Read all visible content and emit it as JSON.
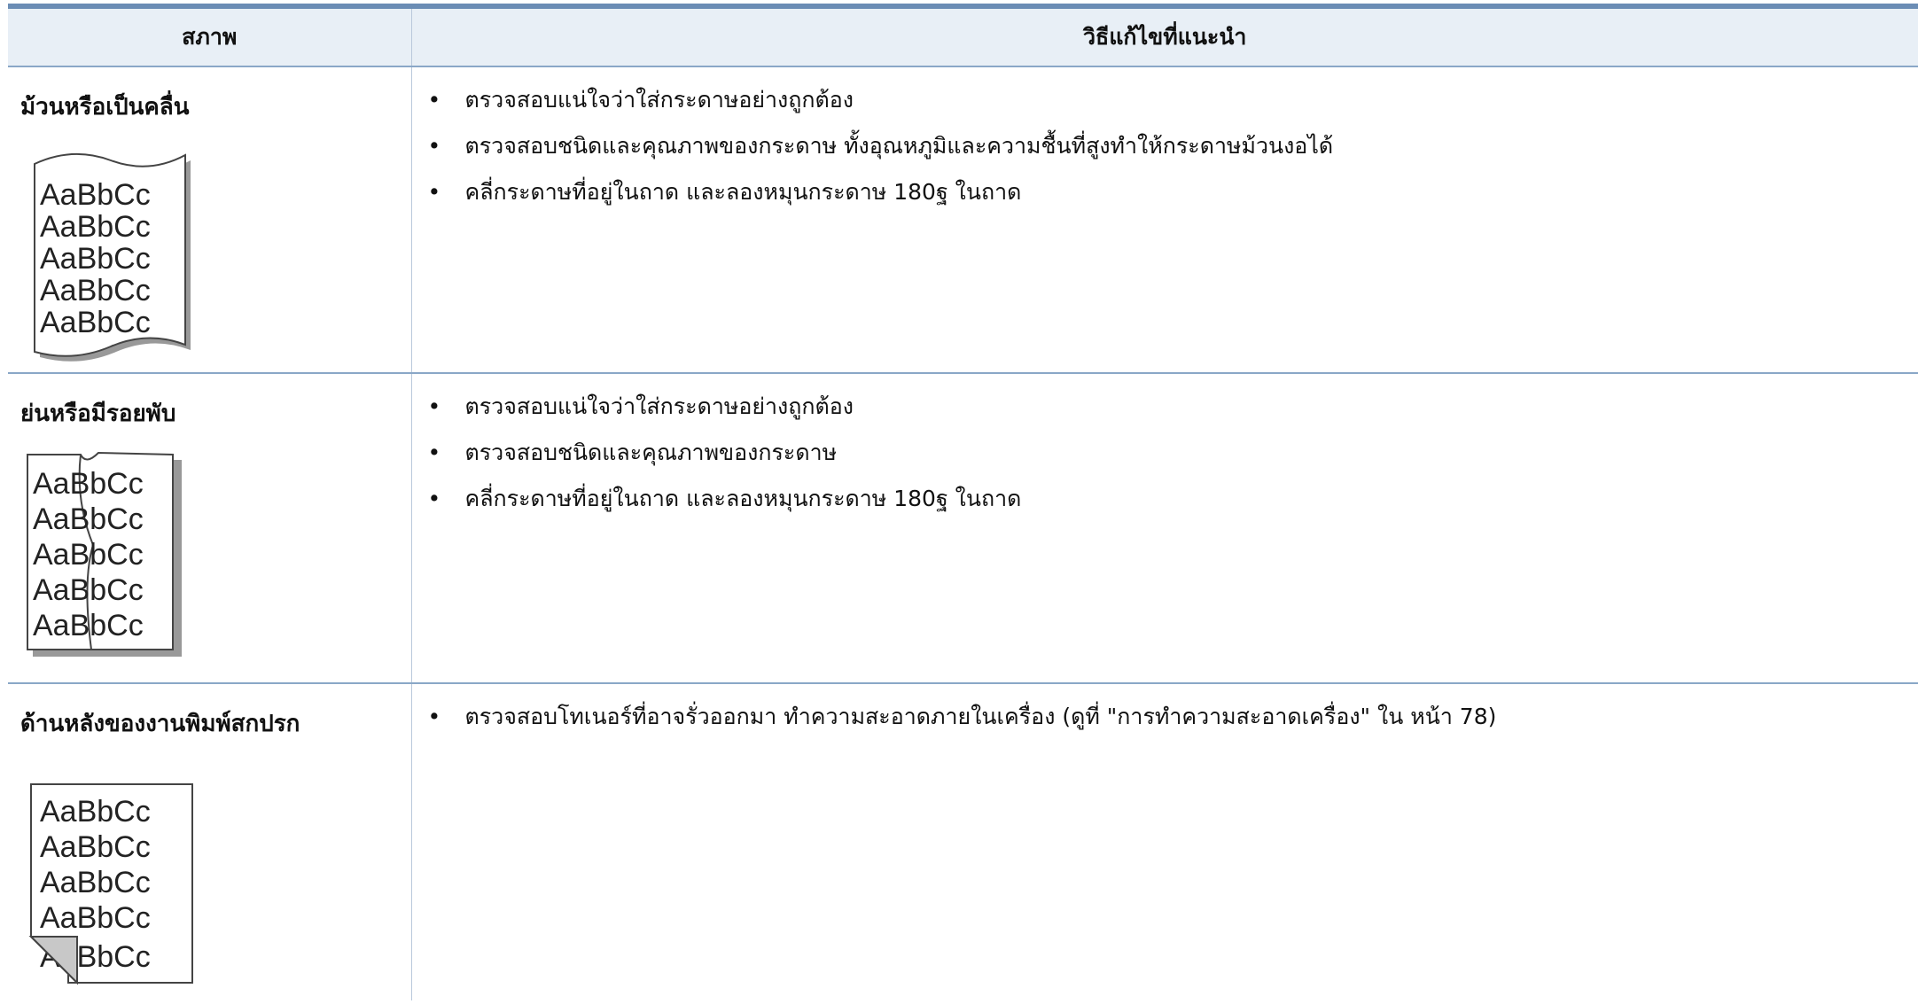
{
  "table": {
    "headers": [
      "สภาพ",
      "วิธีแก้ไขที่แนะนำ"
    ],
    "rows": [
      {
        "condition": "ม้วนหรือเป็นคลื่น",
        "sample_text": "AaBbCc",
        "solutions": [
          "ตรวจสอบแน่ใจว่าใส่กระดาษอย่างถูกต้อง",
          "ตรวจสอบชนิดและคุณภาพของกระดาษ ทั้งอุณหภูมิและความชื้นที่สูงทำให้กระดาษม้วนงอได้",
          "คลี่กระดาษที่อยู่ในถาด และลองหมุนกระดาษ 180ฐ ในถาด"
        ]
      },
      {
        "condition": "ย่นหรือมีรอยพับ",
        "sample_text": "AaBbCc",
        "solutions": [
          "ตรวจสอบแน่ใจว่าใส่กระดาษอย่างถูกต้อง",
          "ตรวจสอบชนิดและคุณภาพของกระดาษ",
          "คลี่กระดาษที่อยู่ในถาด และลองหมุนกระดาษ 180ฐ ในถาด"
        ]
      },
      {
        "condition": "ด้านหลังของงานพิมพ์สกปรก",
        "sample_text": "AaBbCc",
        "solutions": [
          "ตรวจสอบโทเนอร์ที่อาจรั่วออกมา ทำความสะอาดภายในเครื่อง (ดูที่ \"การทำความสะอาดเครื่อง\"  ใน หน้า 78)"
        ]
      }
    ]
  },
  "colors": {
    "header_bg": "#e8eff6",
    "rule": "#6b8db5",
    "row_border": "#8aa7c7"
  }
}
